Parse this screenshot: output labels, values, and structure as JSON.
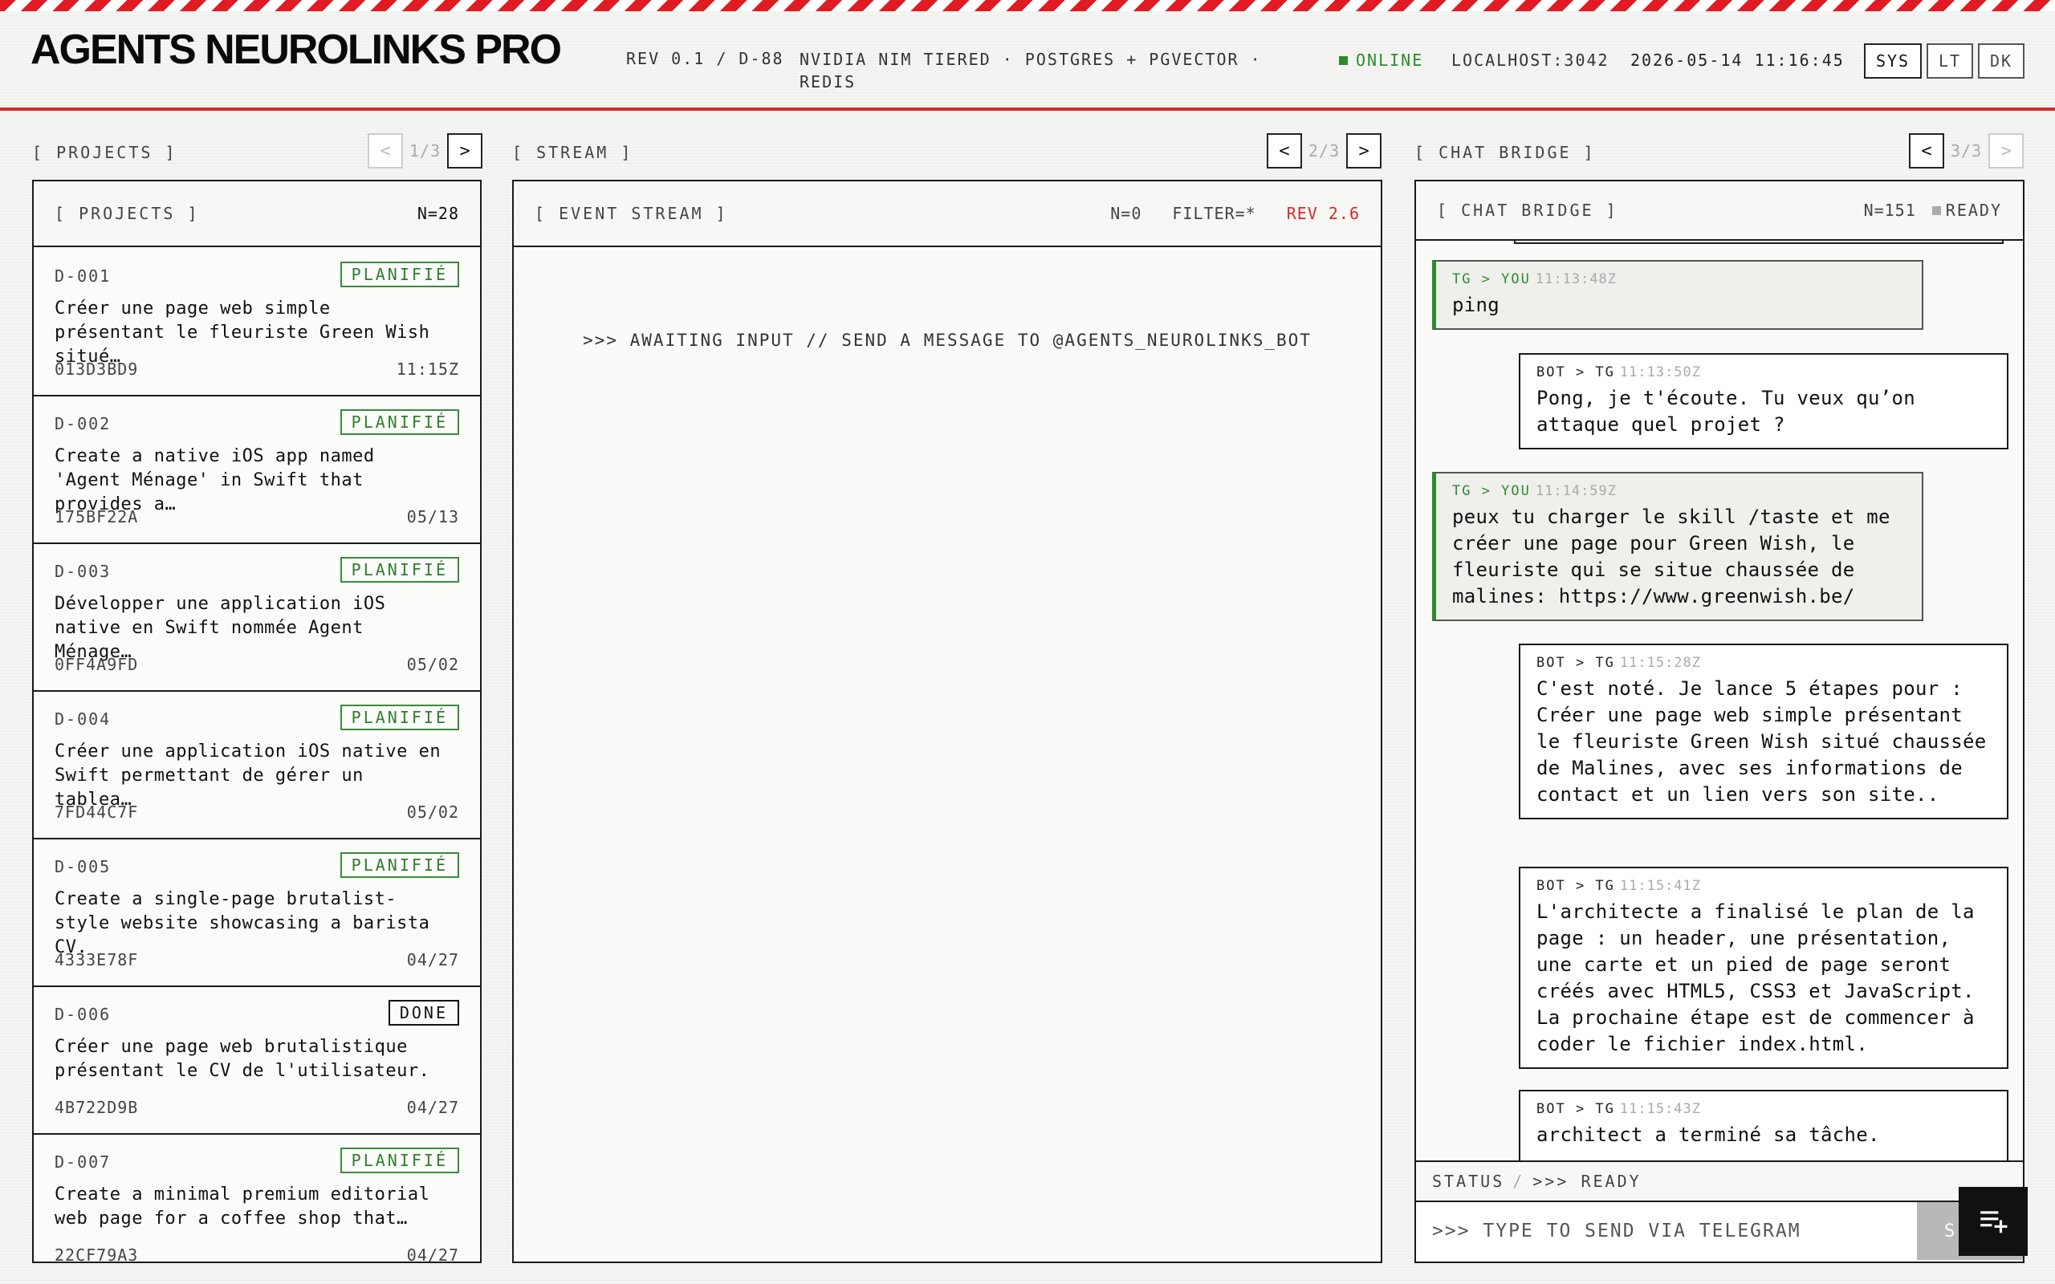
{
  "header": {
    "brand": "AGENTS NEUROLINKS PRO",
    "rev": "REV 0.1 / D-88",
    "stack": "NVIDIA NIM TIERED · POSTGRES + PGVECTOR · REDIS",
    "status": "ONLINE",
    "host": "LOCALHOST:3042",
    "clock": "2026-05-14 11:16:45",
    "buttons": [
      "SYS",
      "LT",
      "DK"
    ]
  },
  "colors": {
    "accent_red": "#d42a2a",
    "status_green": "#2f8a2f",
    "ink": "#111111"
  },
  "projects_col": {
    "label": "[ PROJECTS ]",
    "page": "1/3",
    "prev": "<",
    "next": ">",
    "panel_title": "[ PROJECTS ]",
    "count": "N=28",
    "items": [
      {
        "id": "D-001",
        "status": "PLANIFIÉ",
        "desc": "Créer une page web simple présentant le fleuriste Green Wish situé…",
        "hash": "013D3BD9",
        "date": "11:15Z"
      },
      {
        "id": "D-002",
        "status": "PLANIFIÉ",
        "desc": "Create a native iOS app named 'Agent Ménage' in Swift that provides a…",
        "hash": "175BF22A",
        "date": "05/13"
      },
      {
        "id": "D-003",
        "status": "PLANIFIÉ",
        "desc": "Développer une application iOS native en Swift nommée Agent Ménage…",
        "hash": "0FF4A9FD",
        "date": "05/02"
      },
      {
        "id": "D-004",
        "status": "PLANIFIÉ",
        "desc": "Créer une application iOS native en Swift permettant de gérer un tablea…",
        "hash": "7FD44C7F",
        "date": "05/02"
      },
      {
        "id": "D-005",
        "status": "PLANIFIÉ",
        "desc": "Create a single-page brutalist-style website showcasing a barista CV.",
        "hash": "4333E78F",
        "date": "04/27"
      },
      {
        "id": "D-006",
        "status": "DONE",
        "desc": "Créer une page web brutalistique présentant le CV de l'utilisateur.",
        "hash": "4B722D9B",
        "date": "04/27"
      },
      {
        "id": "D-007",
        "status": "PLANIFIÉ",
        "desc": "Create a minimal premium editorial web page for a coffee shop that…",
        "hash": "22CF79A3",
        "date": "04/27"
      }
    ]
  },
  "stream_col": {
    "label": "[ STREAM ]",
    "page": "2/3",
    "prev": "<",
    "next": ">",
    "panel_title": "[ EVENT STREAM ]",
    "count": "N=0",
    "filter": "FILTER=*",
    "rev": "REV 2.6",
    "awaiting": ">>> AWAITING INPUT // SEND A MESSAGE TO @AGENTS_NEUROLINKS_BOT"
  },
  "chat_col": {
    "label": "[ CHAT BRIDGE ]",
    "page": "3/3",
    "prev": "<",
    "next": ">",
    "panel_title": "[ CHAT BRIDGE ]",
    "count": "N=151",
    "ready": "READY",
    "messages": [
      {
        "who": "TG > YOU",
        "ts": "11:13:48Z",
        "text": "ping"
      },
      {
        "who": "BOT > TG",
        "ts": "11:13:50Z",
        "text": "Pong, je t'écoute. Tu veux qu’on attaque quel projet ?"
      },
      {
        "who": "TG > YOU",
        "ts": "11:14:59Z",
        "text": "peux tu charger le skill /taste et me créer une page pour Green Wish, le fleuriste qui se situe chaussée de malines: https://www.greenwish.be/"
      },
      {
        "who": "BOT > TG",
        "ts": "11:15:28Z",
        "text": "C'est noté. Je lance 5 étapes pour : Créer une page web simple présentant le fleuriste Green Wish situé chaussée de Malines, avec ses informations de contact et un lien vers son site.."
      },
      {
        "who": "BOT > TG",
        "ts": "11:15:41Z",
        "text": "L'architecte a finalisé le plan de la page : un header, une présentation, une carte et un pied de page seront créés avec HTML5, CSS3 et JavaScript. La prochaine étape est de commencer à coder le fichier index.html."
      },
      {
        "who": "BOT > TG",
        "ts": "11:15:43Z",
        "text": "architect a terminé sa tâche."
      }
    ],
    "status_label": "STATUS",
    "status_sep": "/",
    "status_value": ">>> READY",
    "input_placeholder": ">>> TYPE TO SEND VIA TELEGRAM",
    "send_label": "S"
  }
}
